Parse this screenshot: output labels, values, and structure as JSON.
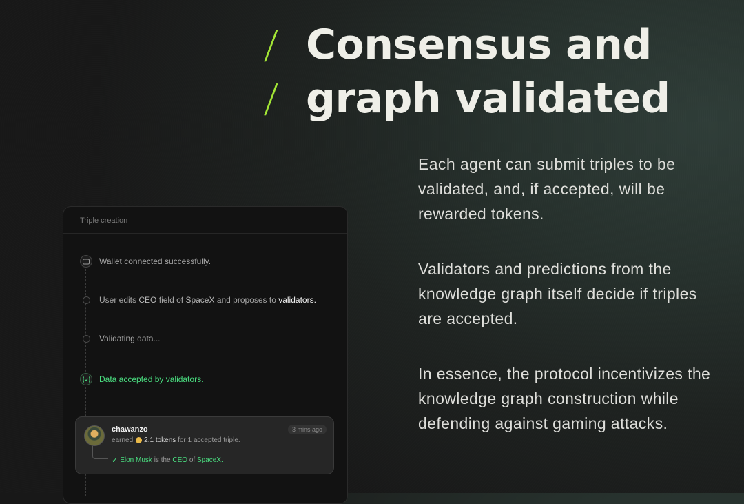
{
  "heading": {
    "slash": "/",
    "line1": "Consensus and",
    "line2": "graph validated"
  },
  "paragraphs": [
    "Each agent can submit triples to be validated, and, if accepted, will be rewarded tokens.",
    "Validators and predictions from the knowledge graph itself decide if triples are accepted.",
    "In essence, the protocol incentivizes the knowledge graph construction while defending against gaming attacks."
  ],
  "panel": {
    "title": "Triple creation",
    "steps": {
      "wallet": "Wallet connected successfully.",
      "edit_prefix": "User edits",
      "edit_field": "CEO",
      "edit_mid1": "field of",
      "edit_entity": "SpaceX",
      "edit_mid2": "and proposes to",
      "edit_target": "validators.",
      "validating": "Validating data...",
      "accepted": "Data accepted by validators."
    },
    "card": {
      "username": "chawanzo",
      "earned_prefix": "earned",
      "tokens": "2.1 tokens",
      "earned_suffix": "for 1 accepted triple.",
      "time": "3 mins ago",
      "subject": "Elon Musk",
      "is_the": "is the",
      "predicate": "CEO",
      "of": "of",
      "object": "SpaceX."
    }
  },
  "colors": {
    "accent": "#a3e635",
    "success": "#4ade80"
  },
  "icons": [
    "wallet-icon",
    "dot-icon",
    "check-bracket-icon",
    "coin-icon",
    "checkmark-icon",
    "avatar"
  ]
}
